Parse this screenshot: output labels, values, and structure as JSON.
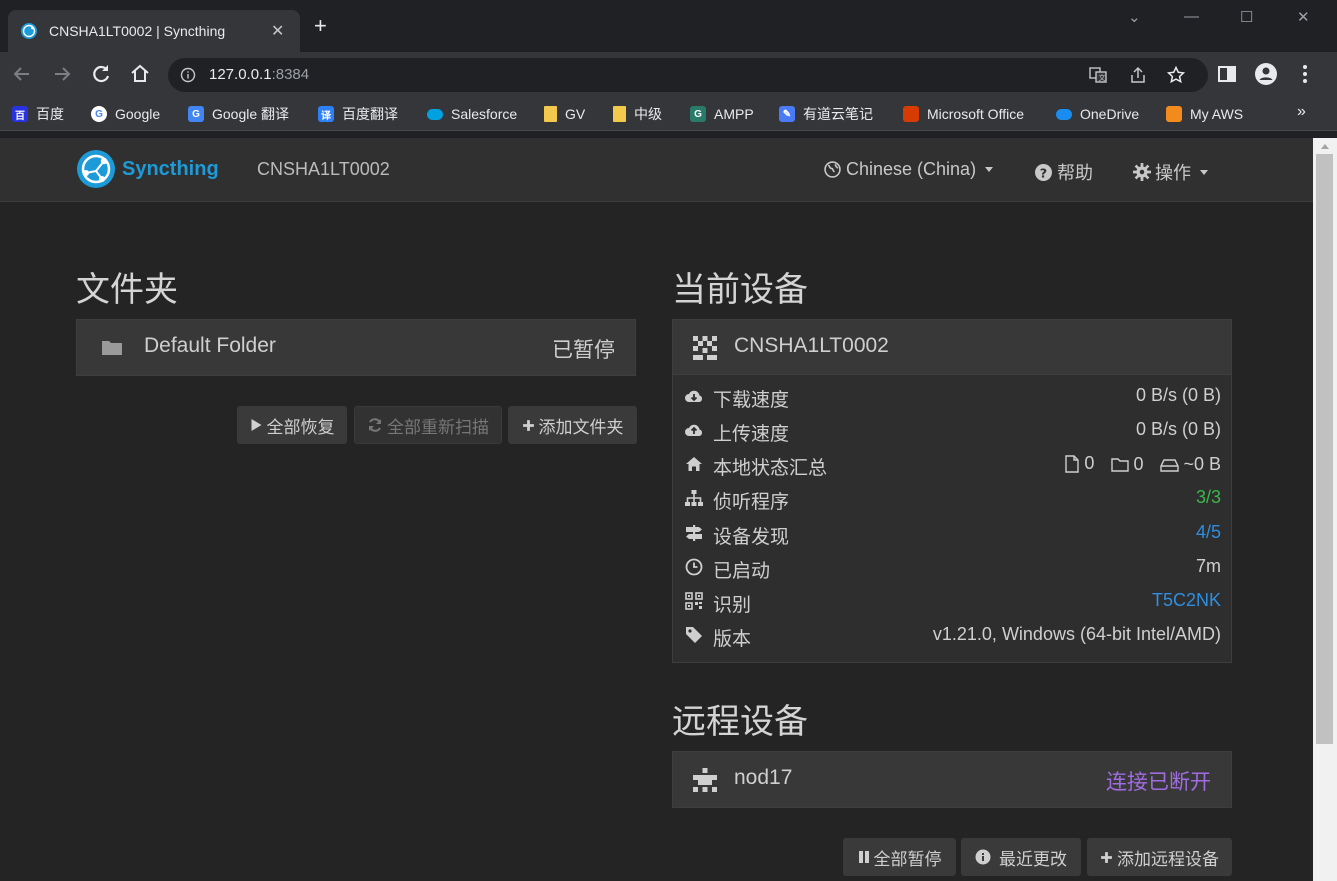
{
  "browser": {
    "tab_title": "CNSHA1LT0002 | Syncthing",
    "url_host": "127.0.0.1",
    "url_port": ":8384",
    "bookmarks": [
      {
        "label": "百度",
        "icon": "baidu-icon",
        "color": "#2932e1"
      },
      {
        "label": "Google",
        "icon": "google-icon",
        "color": "#ffffff"
      },
      {
        "label": "Google 翻译",
        "icon": "google-translate-icon",
        "color": "#4285f4"
      },
      {
        "label": "百度翻译",
        "icon": "baidu-translate-icon",
        "color": "#2d80f6"
      },
      {
        "label": "Salesforce",
        "icon": "salesforce-cloud-icon",
        "color": "#00a1e0"
      },
      {
        "label": "GV",
        "icon": "folder-icon",
        "color": "#f2c94c"
      },
      {
        "label": "中级",
        "icon": "folder-icon",
        "color": "#f2c94c"
      },
      {
        "label": "AMPP",
        "icon": "ampp-icon",
        "color": "#2a7a6a"
      },
      {
        "label": "有道云笔记",
        "icon": "youdao-note-icon",
        "color": "#4a7bf7"
      },
      {
        "label": "Microsoft Office",
        "icon": "office-icon",
        "color": "#d83b01"
      },
      {
        "label": "OneDrive",
        "icon": "onedrive-icon",
        "color": "#1a8ef0"
      },
      {
        "label": "My AWS",
        "icon": "aws-icon",
        "color": "#f38b1c"
      }
    ],
    "bookmarks_more": "»"
  },
  "app": {
    "brand": "Syncthing",
    "device_name": "CNSHA1LT0002",
    "language": "Chinese (China)",
    "help": "帮助",
    "actions": "操作",
    "accent": "#1d9bd8"
  },
  "folders": {
    "heading": "文件夹",
    "items": [
      {
        "name": "Default Folder",
        "status": "已暂停"
      }
    ],
    "buttons": {
      "resume_all": "全部恢复",
      "rescan_all": "全部重新扫描",
      "add_folder": "添加文件夹"
    }
  },
  "this_device": {
    "heading": "当前设备",
    "name": "CNSHA1LT0002",
    "rows": {
      "download_label": "下载速度",
      "download_value": "0 B/s (0 B)",
      "upload_label": "上传速度",
      "upload_value": "0 B/s (0 B)",
      "local_state_label": "本地状态汇总",
      "local_files": "0",
      "local_dirs": "0",
      "local_size": "~0 B",
      "listeners_label": "侦听程序",
      "listeners_value": "3/3",
      "discovery_label": "设备发现",
      "discovery_value": "4/5",
      "uptime_label": "已启动",
      "uptime_value": "7m",
      "id_label": "识别",
      "id_value": "T5C2NK",
      "version_label": "版本",
      "version_value": "v1.21.0, Windows (64-bit Intel/AMD)"
    }
  },
  "remote_devices": {
    "heading": "远程设备",
    "items": [
      {
        "name": "nod17",
        "status": "连接已断开"
      }
    ],
    "buttons": {
      "pause_all": "全部暂停",
      "recent_changes": "最近更改",
      "add_remote": "添加远程设备"
    }
  }
}
